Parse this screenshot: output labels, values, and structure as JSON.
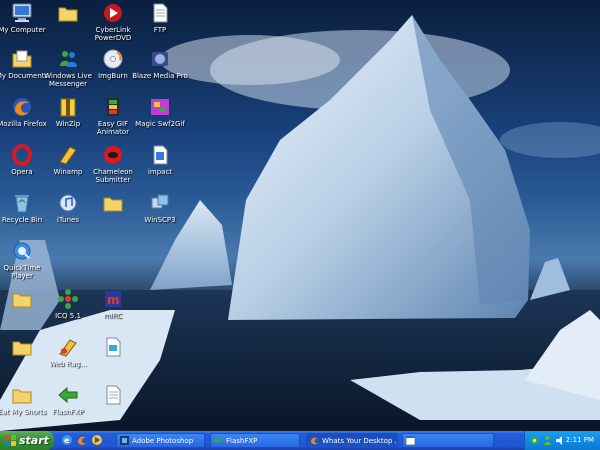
{
  "desktop": {
    "icons": [
      {
        "label": "My Computer",
        "icon": "computer-icon"
      },
      {
        "label": "",
        "icon": "folder-icon"
      },
      {
        "label": "CyberLink PowerDVD",
        "icon": "powerdvd-icon"
      },
      {
        "label": "FTP",
        "icon": "document-icon"
      },
      {
        "label": "My Documents",
        "icon": "documents-folder-icon"
      },
      {
        "label": "Windows Live Messenger",
        "icon": "messenger-icon"
      },
      {
        "label": "ImgBurn",
        "icon": "disc-icon"
      },
      {
        "label": "Blaze Media Pro",
        "icon": "blaze-icon"
      },
      {
        "label": "Mozilla Firefox",
        "icon": "firefox-icon"
      },
      {
        "label": "WinZip",
        "icon": "winzip-icon"
      },
      {
        "label": "Easy GIF Animator",
        "icon": "gif-animator-icon"
      },
      {
        "label": "Magic Swf2Gif",
        "icon": "swf2gif-icon"
      },
      {
        "label": "Opera",
        "icon": "opera-icon"
      },
      {
        "label": "Winamp",
        "icon": "winamp-icon"
      },
      {
        "label": "Chameleon Submitter",
        "icon": "chameleon-icon"
      },
      {
        "label": "impact",
        "icon": "document-icon"
      },
      {
        "label": "Recycle Bin",
        "icon": "recycle-bin-icon"
      },
      {
        "label": "iTunes",
        "icon": "itunes-icon"
      },
      {
        "label": "",
        "icon": "folder-icon"
      },
      {
        "label": "WinSCP3",
        "icon": "winscp-icon"
      },
      {
        "label": "QuickTime Player",
        "icon": "quicktime-icon"
      },
      {
        "label": "",
        "icon": "folder-icon"
      },
      {
        "label": "ICQ 5.1",
        "icon": "icq-icon"
      },
      {
        "label": "mIRC",
        "icon": "mirc-icon"
      },
      {
        "label": "",
        "icon": "folder-icon"
      },
      {
        "label": "Web Rag...",
        "icon": "web-rag-icon"
      },
      {
        "label": "",
        "icon": "document-icon"
      },
      {
        "label": "Eat My Shorts",
        "icon": "folder-icon"
      },
      {
        "label": "FlashFXP",
        "icon": "flashfxp-icon"
      },
      {
        "label": "",
        "icon": "document-icon"
      }
    ]
  },
  "taskbar": {
    "start_label": "start",
    "quick_launch": [
      {
        "icon": "ie-icon"
      },
      {
        "icon": "firefox-icon"
      },
      {
        "icon": "media-icon"
      }
    ],
    "tasks": [
      {
        "label": "Adobe Photoshop",
        "icon": "photoshop-icon"
      },
      {
        "label": "FlashFXP",
        "icon": "flashfxp-icon"
      },
      {
        "label": "Whats Your Desktop ...",
        "icon": "firefox-icon"
      },
      {
        "label": "",
        "icon": "window-icon"
      }
    ],
    "tray": {
      "clock": "2:11 PM"
    }
  }
}
